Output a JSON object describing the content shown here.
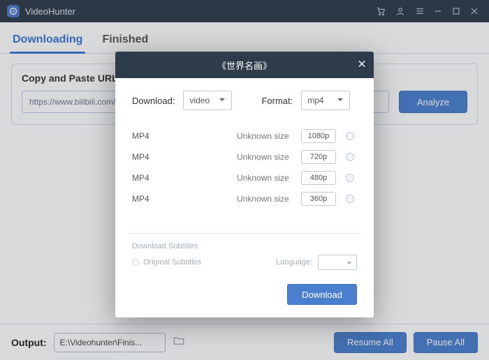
{
  "app": {
    "title": "VideoHunter"
  },
  "tabs": {
    "downloading": "Downloading",
    "finished": "Finished"
  },
  "urlpanel": {
    "title": "Copy and Paste URL",
    "url_text": "https://www.bilibili.com/v",
    "analyze": "Analyze"
  },
  "footer": {
    "output_label": "Output:",
    "output_path": "E:\\Videohunter\\Finis...",
    "resume": "Resume All",
    "pause": "Pause All"
  },
  "modal": {
    "title": "《世界名画》",
    "download_label": "Download:",
    "download_value": "video",
    "format_label": "Format:",
    "format_value": "mp4",
    "unknown": "Unknown size",
    "rows": [
      {
        "fmt": "MP4",
        "res": "1080p"
      },
      {
        "fmt": "MP4",
        "res": "720p"
      },
      {
        "fmt": "MP4",
        "res": "480p"
      },
      {
        "fmt": "MP4",
        "res": "360p"
      }
    ],
    "subs_title": "Download Subtitles",
    "subs_orig": "Original Subtitles",
    "lang_label": "Language:",
    "dl_btn": "Download"
  }
}
